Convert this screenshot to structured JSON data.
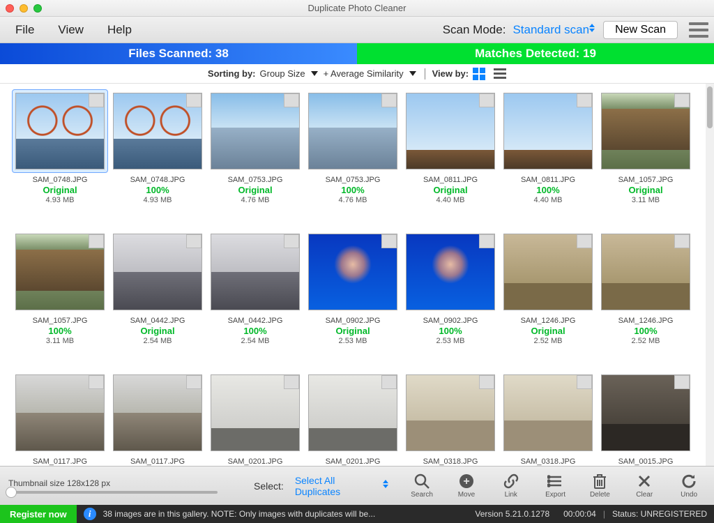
{
  "window": {
    "title": "Duplicate Photo Cleaner"
  },
  "menu": {
    "file": "File",
    "view": "View",
    "help": "Help",
    "scan_mode_label": "Scan Mode:",
    "scan_mode_value": "Standard scan",
    "new_scan": "New Scan"
  },
  "stats": {
    "scanned": "Files Scanned: 38",
    "matches": "Matches Detected: 19"
  },
  "sort": {
    "sorting_by": "Sorting by:",
    "group_size": "Group Size",
    "avg_sim": "+ Average Similarity",
    "view_by": "View by:"
  },
  "thumbs": [
    {
      "file": "SAM_0748.JPG",
      "status": "Original",
      "size": "4.93 MB",
      "cls": "bridge",
      "sel": true
    },
    {
      "file": "SAM_0748.JPG",
      "status": "100%",
      "size": "4.93 MB",
      "cls": "bridge"
    },
    {
      "file": "SAM_0753.JPG",
      "status": "Original",
      "size": "4.76 MB",
      "cls": "city"
    },
    {
      "file": "SAM_0753.JPG",
      "status": "100%",
      "size": "4.76 MB",
      "cls": "city"
    },
    {
      "file": "SAM_0811.JPG",
      "status": "Original",
      "size": "4.40 MB",
      "cls": "garden"
    },
    {
      "file": "SAM_0811.JPG",
      "status": "100%",
      "size": "4.40 MB",
      "cls": "garden"
    },
    {
      "file": "SAM_1057.JPG",
      "status": "Original",
      "size": "3.11 MB",
      "cls": "forest"
    },
    {
      "file": "SAM_1057.JPG",
      "status": "100%",
      "size": "3.11 MB",
      "cls": "forest"
    },
    {
      "file": "SAM_0442.JPG",
      "status": "Original",
      "size": "2.54 MB",
      "cls": "bldg"
    },
    {
      "file": "SAM_0442.JPG",
      "status": "100%",
      "size": "2.54 MB",
      "cls": "bldg"
    },
    {
      "file": "SAM_0902.JPG",
      "status": "Original",
      "size": "2.53 MB",
      "cls": "jelly"
    },
    {
      "file": "SAM_0902.JPG",
      "status": "100%",
      "size": "2.53 MB",
      "cls": "jelly"
    },
    {
      "file": "SAM_1246.JPG",
      "status": "Original",
      "size": "2.52 MB",
      "cls": "wood"
    },
    {
      "file": "SAM_1246.JPG",
      "status": "100%",
      "size": "2.52 MB",
      "cls": "wood"
    },
    {
      "file": "SAM_0117.JPG",
      "status": "",
      "size": "",
      "cls": "street"
    },
    {
      "file": "SAM_0117.JPG",
      "status": "",
      "size": "",
      "cls": "street"
    },
    {
      "file": "SAM_0201.JPG",
      "status": "",
      "size": "",
      "cls": "tree"
    },
    {
      "file": "SAM_0201.JPG",
      "status": "",
      "size": "",
      "cls": "tree"
    },
    {
      "file": "SAM_0318.JPG",
      "status": "",
      "size": "",
      "cls": "beach"
    },
    {
      "file": "SAM_0318.JPG",
      "status": "",
      "size": "",
      "cls": "beach"
    },
    {
      "file": "SAM_0015.JPG",
      "status": "",
      "size": "",
      "cls": "alley"
    }
  ],
  "bottom": {
    "thumb_label": "Thumbnail size 128x128 px",
    "select_label": "Select:",
    "select_value": "Select All Duplicates",
    "actions": {
      "search": "Search",
      "move": "Move",
      "link": "Link",
      "export": "Export",
      "delete": "Delete",
      "clear": "Clear",
      "undo": "Undo"
    }
  },
  "status": {
    "register": "Register now",
    "info": "38 images are in this gallery. NOTE: Only images with duplicates will be...",
    "version": "Version 5.21.0.1278",
    "time": "00:00:04",
    "reg": "Status:  UNREGISTERED"
  }
}
